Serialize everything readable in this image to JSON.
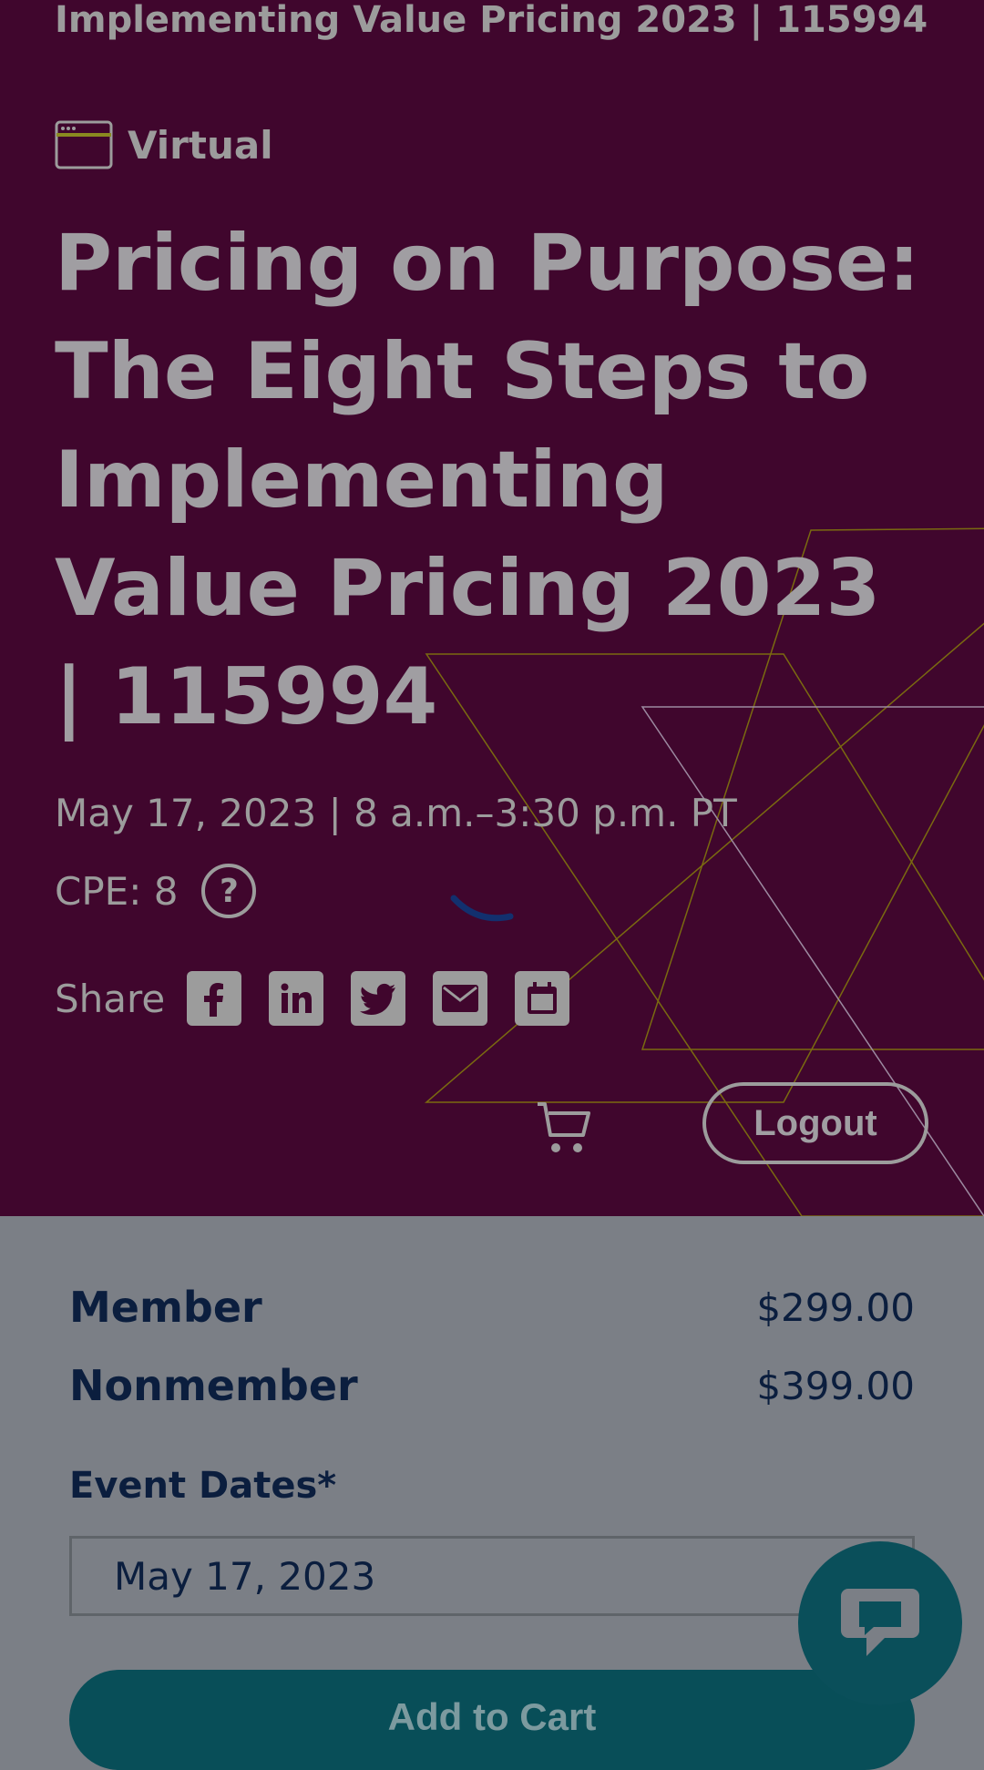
{
  "header": {
    "top_title": "Implementing Value Pricing 2023 | 115994",
    "format_label": "Virtual",
    "format_icon": "browser-window-icon"
  },
  "event": {
    "title": "Pricing on Purpose: The Eight Steps to Implementing Value Pricing 2023 | 115994",
    "date_time": "May 17, 2023 | 8 a.m.–3:30 p.m. PT",
    "cpe": "CPE: 8",
    "help_glyph": "?"
  },
  "share": {
    "label": "Share",
    "icons": [
      "facebook-icon",
      "linkedin-icon",
      "twitter-icon",
      "email-icon",
      "calendar-icon"
    ]
  },
  "account": {
    "logout_label": "Logout",
    "cart_icon": "cart-icon"
  },
  "pricing": [
    {
      "name": "Member",
      "price": "$299.00"
    },
    {
      "name": "Nonmember",
      "price": "$399.00"
    }
  ],
  "registration": {
    "dates_label": "Event Dates*",
    "selected_date": "May 17, 2023",
    "add_to_cart_label": "Add to Cart"
  },
  "chat": {
    "icon": "chat-bubble-icon"
  },
  "colors": {
    "hero_background": "#40062d",
    "overlay_background": "#7b7f86",
    "primary_button": "#084e58",
    "text_dark": "#0b1e3e",
    "deco_gold": "#9a8a0a"
  }
}
